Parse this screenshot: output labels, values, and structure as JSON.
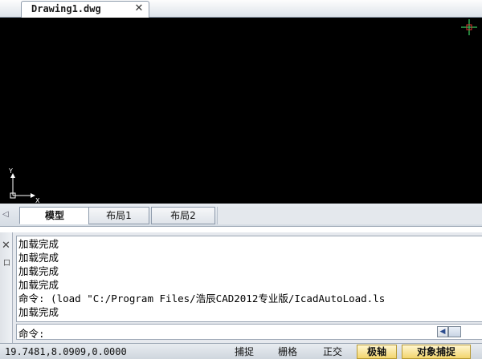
{
  "document_tab": {
    "title": "Drawing1.dwg",
    "close_glyph": "✕"
  },
  "canvas": {
    "background": "#000000",
    "ucs_icon": "ucs-axis-icon",
    "ucs_x_label": "X",
    "ucs_y_label": "Y",
    "crosshair_color": "#2fa84f"
  },
  "layout_tabs": {
    "arrow_glyph": "◁",
    "tabs": [
      {
        "label": "模型",
        "active": true
      },
      {
        "label": "布局1",
        "active": false
      },
      {
        "label": "布局2",
        "active": false
      }
    ]
  },
  "command_window": {
    "close_glyph": "✕",
    "pin_glyph": "口",
    "history": [
      "加载完成",
      "加载完成",
      "加载完成",
      "加载完成",
      "命令: (load \"C:/Program Files/浩辰CAD2012专业版/IcadAutoLoad.ls",
      "加载完成"
    ],
    "prompt": "命令:",
    "scroll_left_glyph": "◀"
  },
  "status_bar": {
    "coordinates": "19.7481,8.0909,0.0000",
    "buttons": [
      {
        "label": "捕捉",
        "on": false
      },
      {
        "label": "栅格",
        "on": false
      },
      {
        "label": "正交",
        "on": false
      },
      {
        "label": "极轴",
        "on": true
      },
      {
        "label": "对象捕捉",
        "on": true
      }
    ]
  }
}
